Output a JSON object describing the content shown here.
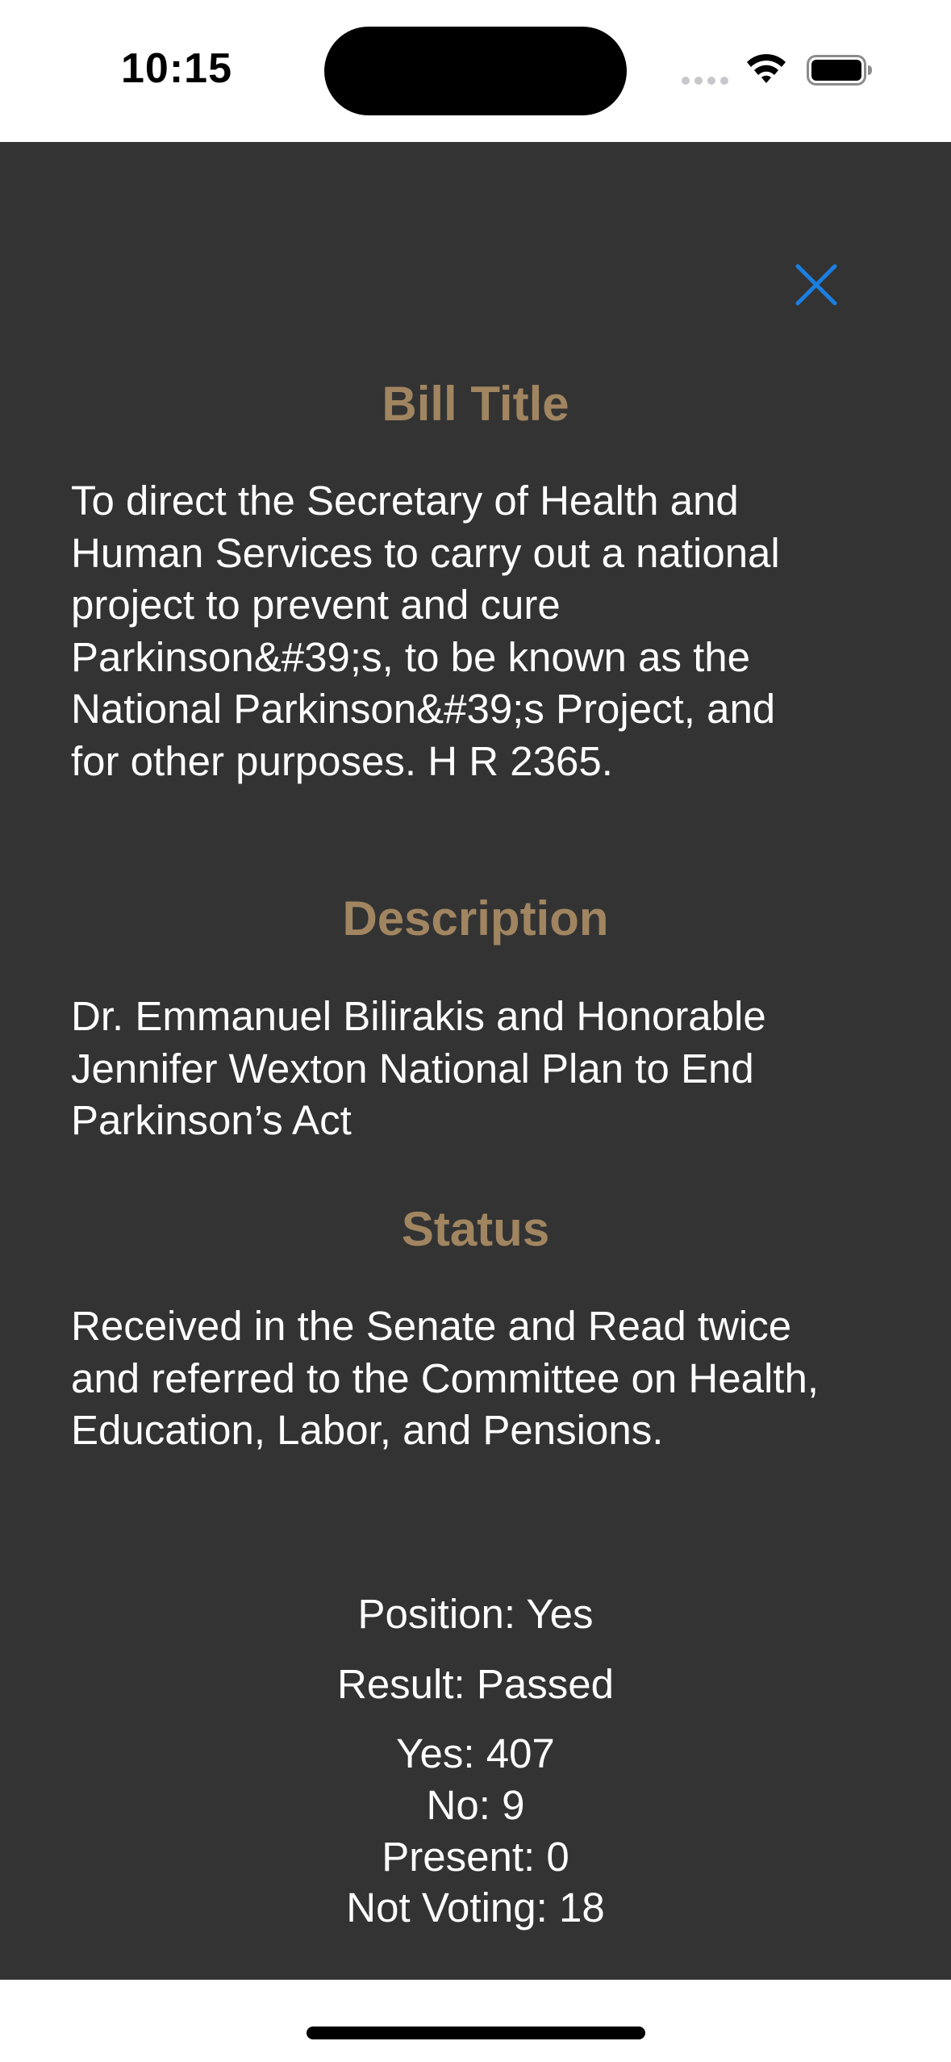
{
  "status_bar": {
    "time": "10:15",
    "icons": [
      "cellular-signal-icon",
      "wifi-icon",
      "battery-icon"
    ]
  },
  "sheet": {
    "close_icon": "close-icon",
    "accent_color": "#a08560",
    "background_color": "#333333",
    "close_color": "#1a7fe0",
    "bill_title": {
      "heading": "Bill Title",
      "lines": [
        "To direct the Secretary of Health and",
        "Human Services to carry out a national",
        "project to prevent and cure",
        "Parkinson&#39;s, to be known as the",
        "National Parkinson&#39;s Project, and",
        "for other purposes. H R 2365."
      ]
    },
    "description": {
      "heading": "Description",
      "lines": [
        "Dr. Emmanuel Bilirakis and Honorable",
        "Jennifer Wexton National Plan to End",
        "Parkinson’s Act"
      ]
    },
    "status": {
      "heading": "Status",
      "lines": [
        "Received in the Senate and Read twice",
        "and referred to the Committee on Health,",
        "Education, Labor, and Pensions."
      ]
    },
    "vote": {
      "position": "Position: Yes",
      "result": "Result: Passed",
      "yes": "Yes: 407",
      "no": "No: 9",
      "present": "Present: 0",
      "not_voting": "Not Voting: 18"
    }
  }
}
